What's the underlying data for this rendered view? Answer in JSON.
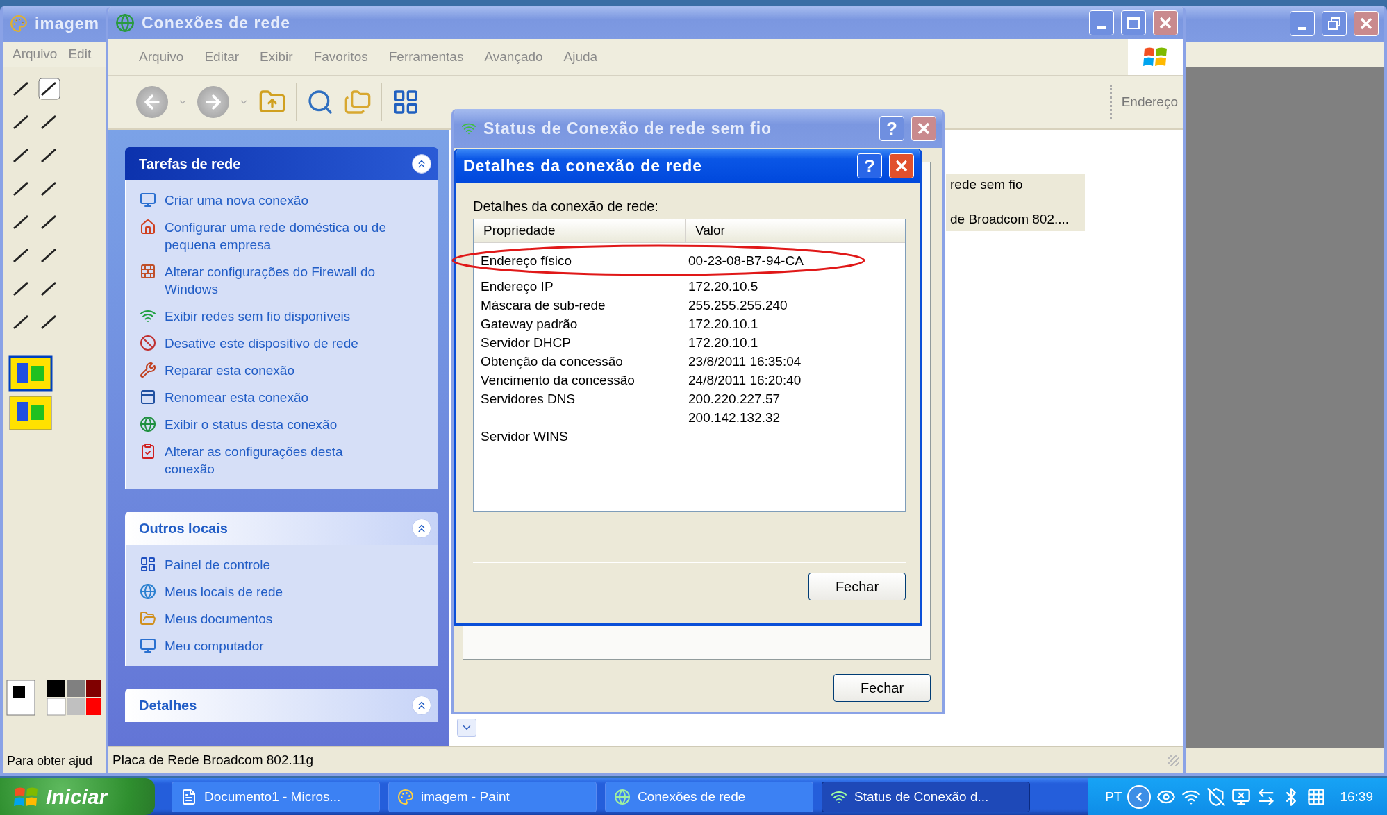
{
  "paint_window": {
    "title": "imagem",
    "menu": [
      "Arquivo",
      "Edit"
    ],
    "status_text": "Para obter ajud"
  },
  "network_window": {
    "title": "Conexões de rede",
    "menu": [
      "Arquivo",
      "Editar",
      "Exibir",
      "Favoritos",
      "Ferramentas",
      "Avançado",
      "Ajuda"
    ],
    "address_label": "Endereço",
    "task_panels": [
      {
        "kind": "special",
        "title": "Tarefas de rede",
        "expanded": true,
        "items": [
          "Criar uma nova conexão",
          "Configurar uma rede doméstica ou de pequena empresa",
          "Alterar configurações do Firewall do Windows",
          "Exibir redes sem fio disponíveis",
          "Desative este dispositivo de rede",
          "Reparar esta conexão",
          "Renomear esta conexão",
          "Exibir o status desta conexão",
          "Alterar as configurações desta conexão"
        ]
      },
      {
        "kind": "normal",
        "title": "Outros locais",
        "expanded": true,
        "items": [
          "Painel de controle",
          "Meus locais de rede",
          "Meus documentos",
          "Meu computador"
        ]
      },
      {
        "kind": "normal",
        "title": "Detalhes",
        "expanded": true
      }
    ],
    "connection_lines": [
      "rede sem fio",
      "de Broadcom 802...."
    ],
    "status_text": "Placa de Rede Broadcom 802.11g"
  },
  "status_dialog": {
    "title": "Status de Conexão de rede sem fio",
    "help_button": "?",
    "close_button": "Fechar"
  },
  "details_dialog": {
    "title": "Detalhes da conexão de rede",
    "help_button": "?",
    "label": "Detalhes da conexão de rede:",
    "columns": [
      "Propriedade",
      "Valor"
    ],
    "rows": [
      {
        "property": "Endereço físico",
        "values": [
          "00-23-08-B7-94-CA"
        ]
      },
      {
        "property": "Endereço IP",
        "values": [
          "172.20.10.5"
        ]
      },
      {
        "property": "Máscara de sub-rede",
        "values": [
          "255.255.255.240"
        ]
      },
      {
        "property": "Gateway padrão",
        "values": [
          "172.20.10.1"
        ]
      },
      {
        "property": "Servidor DHCP",
        "values": [
          "172.20.10.1"
        ]
      },
      {
        "property": "Obtenção da concessão",
        "values": [
          "23/8/2011 16:35:04"
        ]
      },
      {
        "property": "Vencimento da concessão",
        "values": [
          "24/8/2011 16:20:40"
        ]
      },
      {
        "property": "Servidores DNS",
        "values": [
          "200.220.227.57",
          "200.142.132.32"
        ]
      },
      {
        "property": "Servidor WINS"
      }
    ],
    "close_button": "Fechar"
  },
  "annotation": {
    "kind": "ellipse"
  },
  "taskbar": {
    "start": "Iniciar",
    "tasks": [
      {
        "label": "Documento1 - Micros...",
        "selected": false
      },
      {
        "label": "imagem - Paint",
        "selected": false
      },
      {
        "label": "Conexões de rede",
        "selected": false
      },
      {
        "label": "Status de Conexão d...",
        "selected": true
      }
    ],
    "language": "PT",
    "clock": "16:39"
  }
}
